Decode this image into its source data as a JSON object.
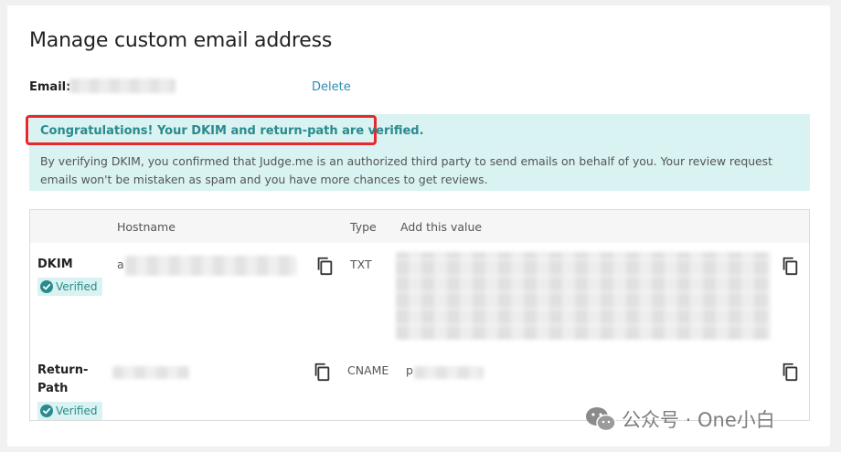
{
  "page": {
    "title": "Manage custom email address"
  },
  "email": {
    "label": "Email:",
    "delete_label": "Delete"
  },
  "banner": {
    "heading": "Congratulations! Your DKIM and return-path are verified.",
    "body": "By verifying DKIM, you confirmed that Judge.me is an authorized third party to send emails on behalf of you. Your review request emails won't be mistaken as spam and you have more chances to get reviews."
  },
  "table": {
    "headers": {
      "hostname": "Hostname",
      "type": "Type",
      "value": "Add this value"
    },
    "rows": [
      {
        "label": "DKIM",
        "type": "TXT",
        "status": "Verified",
        "hostname_prefix": "a",
        "value_prefix": ""
      },
      {
        "label": "Return-Path",
        "type": "CNAME",
        "status": "Verified",
        "hostname_prefix": "",
        "value_prefix": "p"
      }
    ]
  },
  "watermark": {
    "text": "公众号 · One小白"
  },
  "colors": {
    "accent_teal": "#2a8a8d",
    "banner_bg": "#d9f2f2",
    "link": "#2c8fb0",
    "highlight_red": "#e8282c"
  },
  "icons": {
    "copy": "copy-icon",
    "verified": "check-circle-icon",
    "watermark": "wechat-icon"
  }
}
